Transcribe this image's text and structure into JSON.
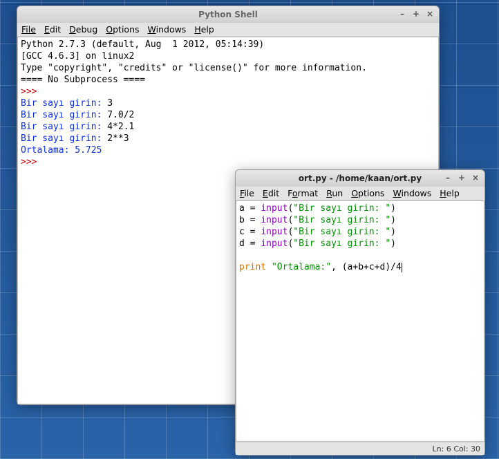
{
  "shell_window": {
    "title": "Python Shell",
    "menus": [
      "File",
      "Edit",
      "Debug",
      "Options",
      "Windows",
      "Help"
    ],
    "header_lines": [
      "Python 2.7.3 (default, Aug  1 2012, 05:14:39) ",
      "[GCC 4.6.3] on linux2",
      "Type \"copyright\", \"credits\" or \"license()\" for more information.",
      "==== No Subprocess ===="
    ],
    "prompt": ">>> ",
    "interactions": [
      {
        "prompt": "Bir sayı girin: ",
        "input": "3"
      },
      {
        "prompt": "Bir sayı girin: ",
        "input": "7.0/2"
      },
      {
        "prompt": "Bir sayı girin: ",
        "input": "4*2.1"
      },
      {
        "prompt": "Bir sayı girin: ",
        "input": "2**3"
      }
    ],
    "result_label": "Ortalama: ",
    "result_value": "5.725",
    "trailing_prompt": ">>> "
  },
  "editor_window": {
    "title": "ort.py - /home/kaan/ort.py",
    "menus": [
      "File",
      "Edit",
      "Format",
      "Run",
      "Options",
      "Windows",
      "Help"
    ],
    "code": {
      "assigns": [
        {
          "var": "a",
          "func": "input",
          "arg": "\"Bir sayı girin: \""
        },
        {
          "var": "b",
          "func": "input",
          "arg": "\"Bir sayı girin: \""
        },
        {
          "var": "c",
          "func": "input",
          "arg": "\"Bir sayı girin: \""
        },
        {
          "var": "d",
          "func": "input",
          "arg": "\"Bir sayı girin: \""
        }
      ],
      "print_kw": "print",
      "print_str": "\"Ortalama:\"",
      "print_expr": ", (a+b+c+d)/4"
    },
    "status": "Ln: 6 Col: 30"
  }
}
